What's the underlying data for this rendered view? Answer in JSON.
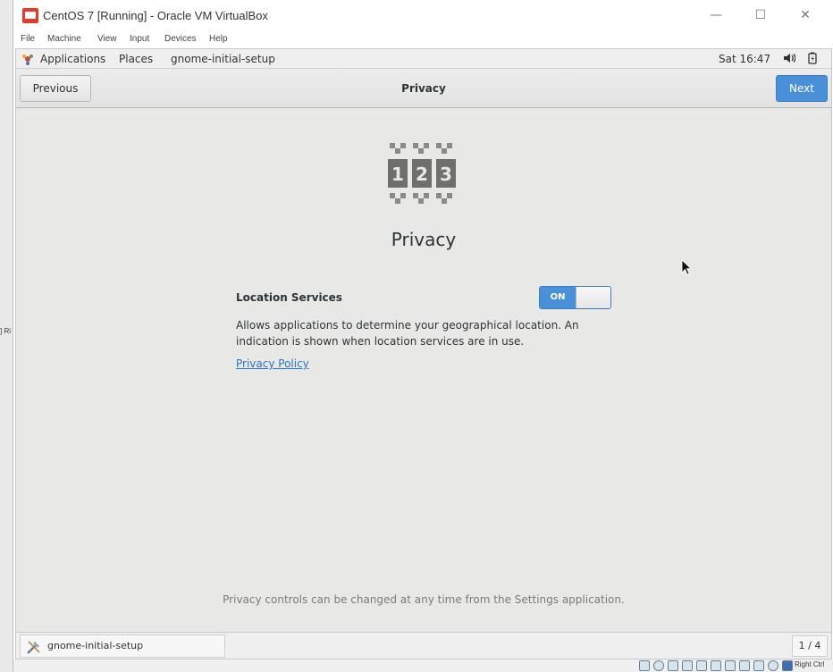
{
  "window": {
    "title": "CentOS 7 [Running] - Oracle VM VirtualBox",
    "minimize_glyph": "—",
    "maximize_glyph": "☐",
    "close_glyph": "✕"
  },
  "menubar": {
    "items": [
      "File",
      "Machine",
      "View",
      "Input",
      "Devices",
      "Help"
    ]
  },
  "host_fragment": "] Ri",
  "topbar": {
    "applications": "Applications",
    "places": "Places",
    "active_app": "gnome-initial-setup",
    "clock": "Sat 16:47",
    "icons": [
      "applications-icon",
      "volume-icon",
      "battery-icon"
    ]
  },
  "headerbar": {
    "previous_label": "Previous",
    "title": "Privacy",
    "next_label": "Next",
    "accent_color": "#4a90d9"
  },
  "page": {
    "heading": "Privacy",
    "icon": "privacy-123-icon",
    "location_services": {
      "label": "Location Services",
      "toggle_label": "ON",
      "enabled": true,
      "description": "Allows applications to determine your geographical location. An indication is shown when location services are in use."
    },
    "policy_link": "Privacy Policy",
    "footer_note": "Privacy controls can be changed at any time from the Settings application."
  },
  "taskbar": {
    "task_label": "gnome-initial-setup",
    "workspace_indicator": "1 / 4"
  },
  "statusbar": {
    "host_key": "Right Ctrl",
    "icons": [
      "hard-disk-icon",
      "optical-drive-icon",
      "audio-icon",
      "network-icon",
      "usb-icon",
      "shared-folders-icon",
      "display-icon",
      "video-capture-icon",
      "cpu-icon",
      "mouse-integration-icon",
      "keyboard-capture-icon"
    ]
  }
}
